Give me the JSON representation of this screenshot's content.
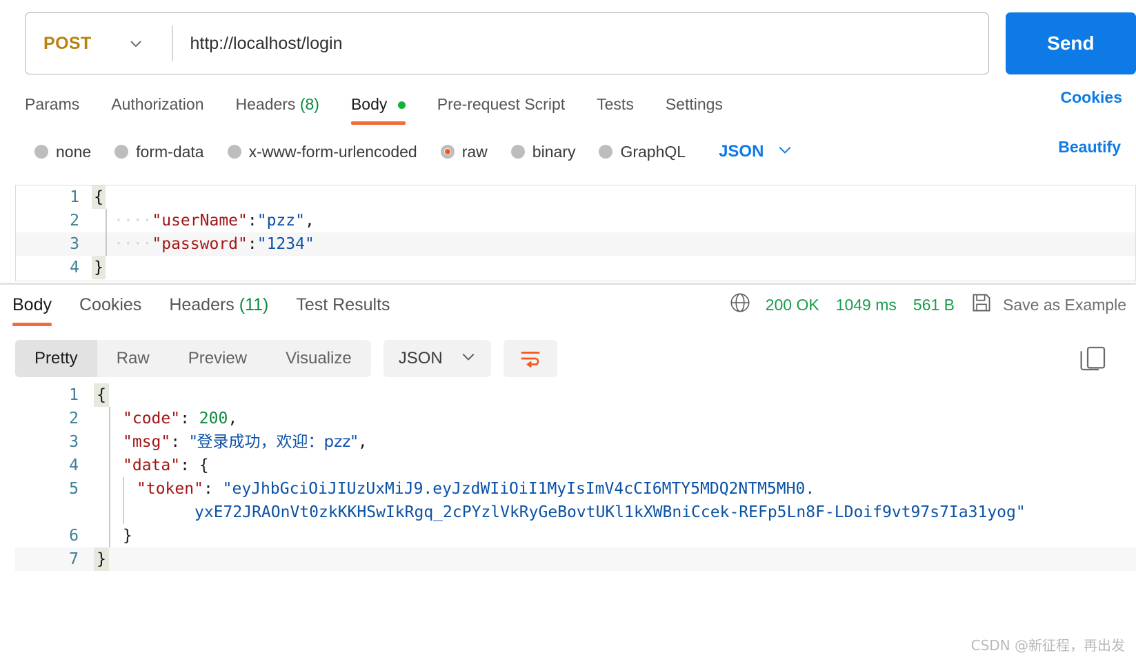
{
  "request": {
    "method": "POST",
    "url": "http://localhost/login",
    "send_label": "Send",
    "tabs": [
      {
        "label": "Params",
        "active": false,
        "badge": "",
        "dot": false
      },
      {
        "label": "Authorization",
        "active": false,
        "badge": "",
        "dot": false
      },
      {
        "label": "Headers",
        "active": false,
        "badge": "(8)",
        "dot": false
      },
      {
        "label": "Body",
        "active": true,
        "badge": "",
        "dot": true
      },
      {
        "label": "Pre-request Script",
        "active": false,
        "badge": "",
        "dot": false
      },
      {
        "label": "Tests",
        "active": false,
        "badge": "",
        "dot": false
      },
      {
        "label": "Settings",
        "active": false,
        "badge": "",
        "dot": false
      }
    ],
    "cookies_link": "Cookies",
    "body_types": [
      {
        "label": "none",
        "selected": false
      },
      {
        "label": "form-data",
        "selected": false
      },
      {
        "label": "x-www-form-urlencoded",
        "selected": false
      },
      {
        "label": "raw",
        "selected": true
      },
      {
        "label": "binary",
        "selected": false
      },
      {
        "label": "GraphQL",
        "selected": false
      }
    ],
    "language": "JSON",
    "beautify_link": "Beautify",
    "body_lines": [
      {
        "n": "1",
        "fold": "{",
        "boxed": true,
        "indent": "",
        "key": "",
        "colon": "",
        "value": "",
        "comma": ""
      },
      {
        "n": "2",
        "fold": "",
        "boxed": false,
        "indent": "····",
        "key": "\"userName\"",
        "colon": ":",
        "value": "\"pzz\"",
        "comma": ","
      },
      {
        "n": "3",
        "fold": "",
        "boxed": false,
        "indent": "····",
        "key": "\"password\"",
        "colon": ":",
        "value": "\"1234\"",
        "comma": ""
      },
      {
        "n": "4",
        "fold": "}",
        "boxed": true,
        "indent": "",
        "key": "",
        "colon": "",
        "value": "",
        "comma": ""
      }
    ]
  },
  "response": {
    "tabs": [
      {
        "label": "Body",
        "active": true,
        "badge": ""
      },
      {
        "label": "Cookies",
        "active": false,
        "badge": ""
      },
      {
        "label": "Headers",
        "active": false,
        "badge": "(11)"
      },
      {
        "label": "Test Results",
        "active": false,
        "badge": ""
      }
    ],
    "status_code": "200 OK",
    "time": "1049 ms",
    "size": "561 B",
    "save_as_example": "Save as Example",
    "view_modes": [
      {
        "label": "Pretty",
        "active": true
      },
      {
        "label": "Raw",
        "active": false
      },
      {
        "label": "Preview",
        "active": false
      },
      {
        "label": "Visualize",
        "active": false
      }
    ],
    "format": "JSON",
    "body_lines": [
      {
        "n": "1",
        "fold": "{",
        "boxed": true,
        "content_type": "brace"
      },
      {
        "n": "2",
        "fold": "",
        "boxed": false,
        "content_type": "pair_num",
        "key": "\"code\"",
        "value": "200",
        "comma": ","
      },
      {
        "n": "3",
        "fold": "",
        "boxed": false,
        "content_type": "pair_str",
        "key": "\"msg\"",
        "value": "\"登录成功，欢迎：pzz\"",
        "comma": ","
      },
      {
        "n": "4",
        "fold": "",
        "boxed": false,
        "content_type": "pair_open",
        "key": "\"data\"",
        "value": "{",
        "comma": ""
      },
      {
        "n": "5",
        "fold": "",
        "boxed": false,
        "content_type": "token",
        "key": "\"token\"",
        "token_part1": "\"eyJhbGciOiJIUzUxMiJ9.eyJzdWIiOiI1MyIsImV4cCI6MTY5MDQ2NTM5MH0.",
        "token_part2": "yxE72JRAOnVt0zkKKHSwIkRgq_2cPYzlVkRyGeBovtUKl1kXWBniCcek-REFp5Ln8F-LDoif9vt97s7Ia31yog\""
      },
      {
        "n": "6",
        "fold": "",
        "boxed": false,
        "content_type": "close_inner",
        "value": "}"
      },
      {
        "n": "7",
        "fold": "}",
        "boxed": true,
        "content_type": "brace"
      }
    ]
  },
  "watermark": "CSDN @新征程，再出发"
}
